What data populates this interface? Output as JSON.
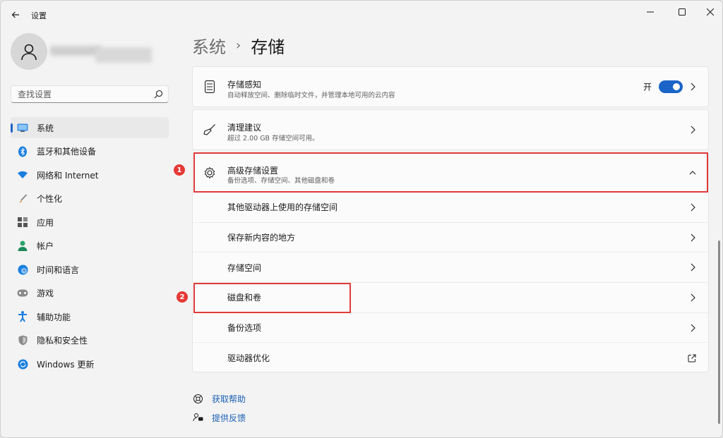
{
  "window": {
    "title": "设置"
  },
  "search": {
    "placeholder": "查找设置"
  },
  "sidebar": {
    "items": [
      {
        "label": "系统",
        "icon": "monitor-icon",
        "active": true
      },
      {
        "label": "蓝牙和其他设备",
        "icon": "bluetooth-icon"
      },
      {
        "label": "网络和 Internet",
        "icon": "wifi-icon"
      },
      {
        "label": "个性化",
        "icon": "brush-icon"
      },
      {
        "label": "应用",
        "icon": "apps-icon"
      },
      {
        "label": "帐户",
        "icon": "person-icon"
      },
      {
        "label": "时间和语言",
        "icon": "globe-clock-icon"
      },
      {
        "label": "游戏",
        "icon": "gamepad-icon"
      },
      {
        "label": "辅助功能",
        "icon": "accessibility-icon"
      },
      {
        "label": "隐私和安全性",
        "icon": "shield-icon"
      },
      {
        "label": "Windows 更新",
        "icon": "update-icon"
      }
    ]
  },
  "breadcrumb": {
    "parent": "系统",
    "separator": "›",
    "current": "存储"
  },
  "cards": {
    "storage_sense": {
      "title": "存储感知",
      "desc": "自动释放空间、删除临时文件，并管理本地可用的云内容",
      "toggle_label": "开",
      "toggle_on": true
    },
    "cleanup": {
      "title": "清理建议",
      "desc": "超过 2.00 GB 存储空间可用。"
    },
    "advanced": {
      "title": "高级存储设置",
      "desc": "备份选项、存储空间、其他磁盘和卷",
      "expanded": true
    }
  },
  "advanced_items": [
    {
      "label": "其他驱动器上使用的存储空间",
      "action": "chevron"
    },
    {
      "label": "保存新内容的地方",
      "action": "chevron"
    },
    {
      "label": "存储空间",
      "action": "chevron"
    },
    {
      "label": "磁盘和卷",
      "action": "chevron"
    },
    {
      "label": "备份选项",
      "action": "chevron"
    },
    {
      "label": "驱动器优化",
      "action": "external-link"
    }
  ],
  "annotations": {
    "marker1": "1",
    "marker2": "2"
  },
  "links": {
    "help": "获取帮助",
    "feedback": "提供反馈"
  },
  "colors": {
    "accent": "#1a64c8",
    "annotation": "#e03a3a",
    "link": "#1a5fb4"
  }
}
